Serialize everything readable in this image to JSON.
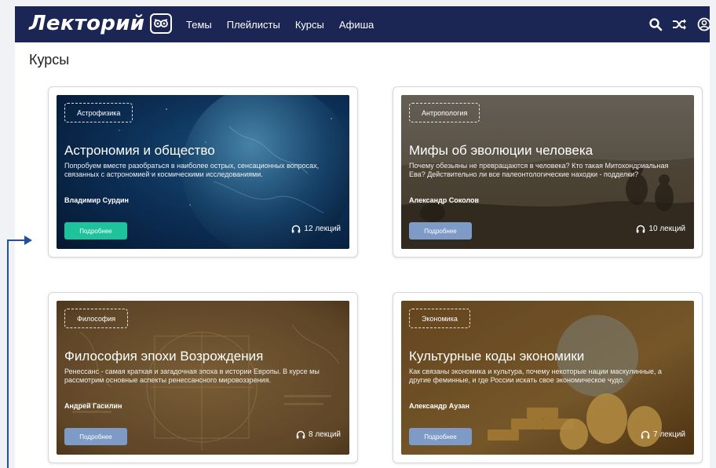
{
  "header": {
    "logo_text": "Лекторий",
    "nav": [
      "Темы",
      "Плейлисты",
      "Курсы",
      "Афиша"
    ],
    "icons": [
      "search-icon",
      "shuffle-icon",
      "user-icon"
    ],
    "background": "#1b2654"
  },
  "page_title": "Курсы",
  "courses": [
    {
      "tag": "Астрофизика",
      "title": "Астрономия и общество",
      "description": "Попробуем вместе разобраться в наиболее острых, сенсационных вопросах, связанных с астрономией и космическими исследованиями.",
      "author": "Владимир Сурдин",
      "button": "Подробнее",
      "lectures": "12 лекций",
      "button_color": "#1ec39c",
      "theme": "space"
    },
    {
      "tag": "Антропология",
      "title": "Мифы об эволюции человека",
      "description": "Почему обезьяны не превращаются в человека? Кто такая Митохондриальная Ева? Действительно ли все палеонтологические находки - подделки?",
      "author": "Александр Соколов",
      "button": "Подробнее",
      "lectures": "10 лекций",
      "button_color": "#7d9bc6",
      "theme": "savanna"
    },
    {
      "tag": "Философия",
      "title": "Философия эпохи Возрождения",
      "description": "Ренессанс - самая краткая и загадочная эпоха в истории Европы. В курсе мы рассмотрим основные аспекты ренессансного мировоззрения.",
      "author": "Андрей Гасилин",
      "button": "Подробнее",
      "lectures": "8 лекций",
      "button_color": "#7d9bc6",
      "theme": "parchment"
    },
    {
      "tag": "Экономика",
      "title": "Культурные коды экономики",
      "description": "Как связаны экономика и культура, почему некоторые нации маскулинные, а другие феминные, и где России искать свое экономическое чудо.",
      "author": "Александр Аузан",
      "button": "Подробнее",
      "lectures": "7 лекций",
      "button_color": "#7d9bc6",
      "theme": "gold"
    }
  ],
  "annotation": {
    "color": "#1f4fa8"
  }
}
